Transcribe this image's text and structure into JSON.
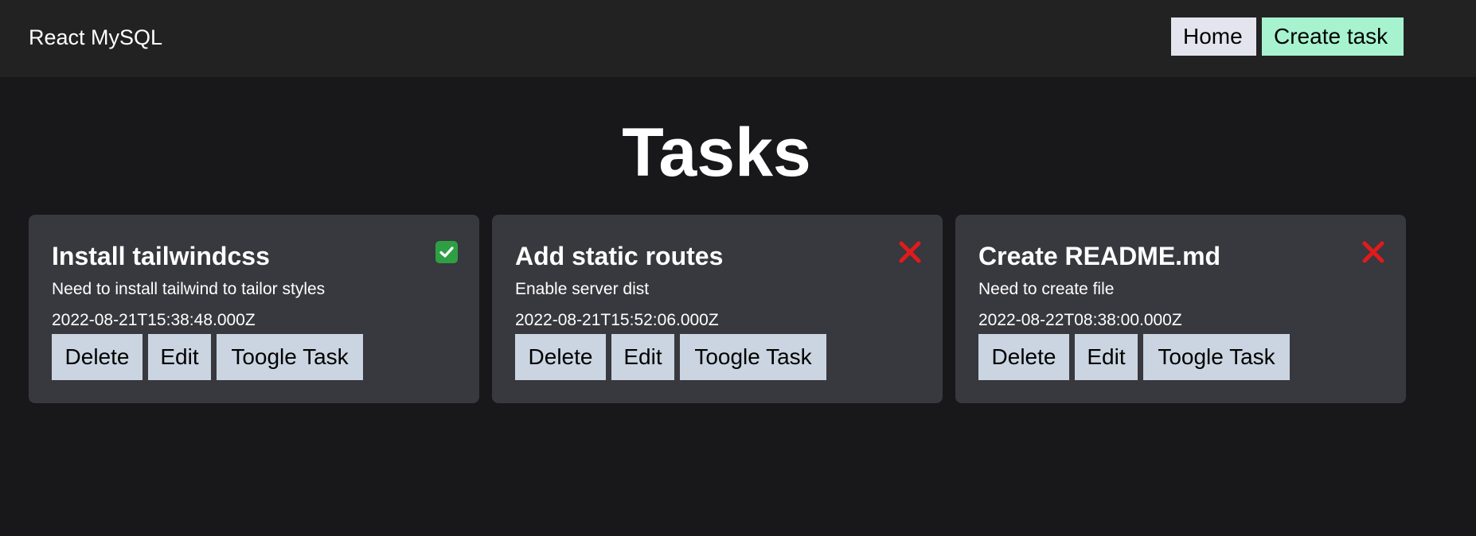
{
  "navbar": {
    "brand": "React MySQL",
    "links": [
      {
        "label": "Home",
        "color": "#e4e4ee"
      },
      {
        "label": "Create task",
        "color": "#a7f3d0"
      }
    ]
  },
  "page": {
    "title": "Tasks"
  },
  "tasks": [
    {
      "title": "Install tailwindcss",
      "description": "Need to install tailwind to tailor styles",
      "created_at": "2022-08-21T15:38:48.000Z",
      "done": true,
      "status_icon": "check-mark-icon",
      "actions": {
        "delete": "Delete",
        "edit": "Edit",
        "toggle": "Toogle Task"
      }
    },
    {
      "title": "Add static routes",
      "description": "Enable server dist",
      "created_at": "2022-08-21T15:52:06.000Z",
      "done": false,
      "status_icon": "cross-mark-icon",
      "actions": {
        "delete": "Delete",
        "edit": "Edit",
        "toggle": "Toogle Task"
      }
    },
    {
      "title": "Create README.md",
      "description": "Need to create file",
      "created_at": "2022-08-22T08:38:00.000Z",
      "done": false,
      "status_icon": "cross-mark-icon",
      "actions": {
        "delete": "Delete",
        "edit": "Edit",
        "toggle": "Toogle Task"
      }
    }
  ],
  "colors": {
    "background": "#18181b",
    "navbar": "#222223",
    "card": "#38383f",
    "action_button": "#cbd5e1",
    "done_green": "#2ea043",
    "not_done_red": "#e01b1b"
  }
}
